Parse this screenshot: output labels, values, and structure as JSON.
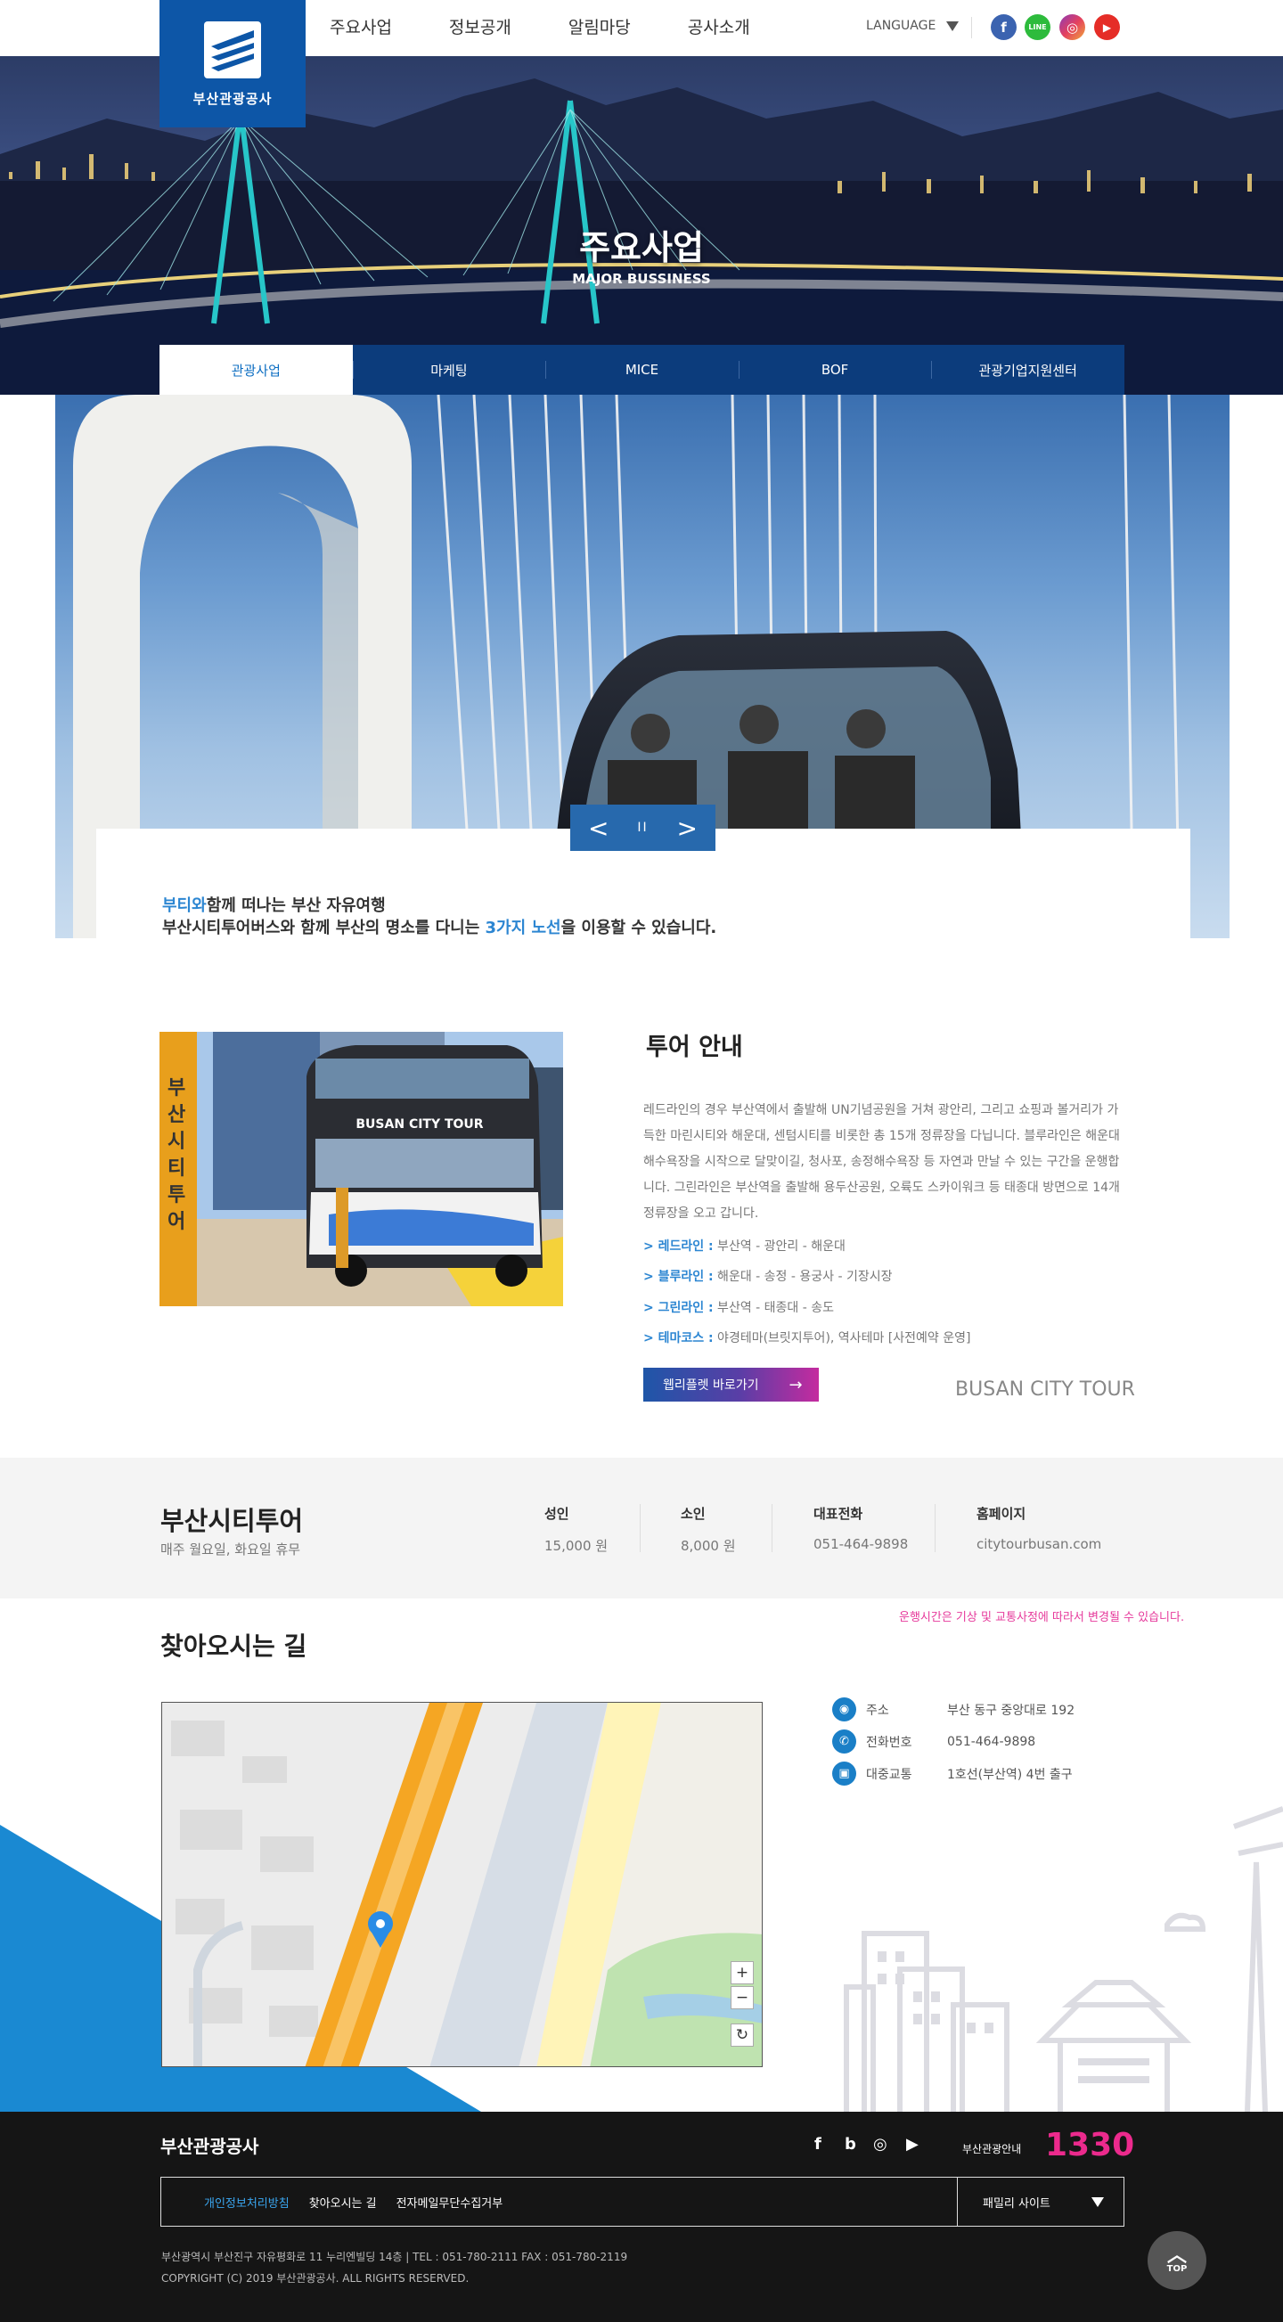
{
  "header": {
    "logo_text": "부산관광공사",
    "nav": [
      "주요사업",
      "정보공개",
      "알림마당",
      "공사소개"
    ],
    "language_label": "LANGUAGE",
    "sns": {
      "facebook": "f",
      "line": "LINE",
      "instagram": "◎",
      "youtube": "▶"
    }
  },
  "visual": {
    "title": "주요사업",
    "subtitle": "MAJOR BUSSINESS"
  },
  "subnav": [
    "관광사업",
    "마케팅",
    "MICE",
    "BOF",
    "관광기업지원센터"
  ],
  "slider": {
    "prev": "<",
    "pause": "II",
    "next": ">"
  },
  "caption": {
    "line1_highlight": "부티와",
    "line1_rest": "함께 떠나는 부산 자유여행",
    "line2_pre": "부산시티투어버스와 함께 부산의 명소를 다니는 ",
    "line2_highlight": "3가지 노선",
    "line2_post": "을 이용할 수 있습니다."
  },
  "tour": {
    "title": "투어 안내",
    "description": "레드라인의 경우 부산역에서 출발해 UN기념공원을 거쳐 광안리, 그리고 쇼핑과 볼거리가 가득한 마린시티와 해운대, 센텀시티를 비롯한 총 15개 정류장을 다닙니다. 블루라인은 해운대해수욕장을 시작으로 달맞이길, 청사포, 송정해수욕장 등 자연과 만날 수 있는 구간을 운행합니다. 그린라인은 부산역을 출발해 용두산공원, 오륙도 스카이워크 등 태종대 방면으로 14개 정류장을 오고 갑니다.",
    "routes": [
      {
        "name": "> 레드라인 :",
        "path": " 부산역 - 광안리 - 해운대"
      },
      {
        "name": "> 블루라인 :",
        "path": " 해운대 - 송정 - 용궁사 - 기장시장"
      },
      {
        "name": "> 그린라인 :",
        "path": " 부산역 - 태종대 - 송도"
      },
      {
        "name": "> 테마코스 :",
        "path": " 야경테마(브릿지투어), 역사테마 [사전예약 운영]"
      }
    ],
    "button_label": "웹리플렛 바로가기",
    "button_arrow": "→",
    "brand_text": "BUSAN CITY TOUR",
    "bus_sign": "BUSAN CITY TOUR"
  },
  "info": {
    "title": "부산시티투어",
    "subtitle": "매주 월요일, 화요일 휴무",
    "adult_label": "성인",
    "adult_price": "15,000 원",
    "child_label": "소인",
    "child_price": "8,000 원",
    "tel_label": "대표전화",
    "tel_value": "051-464-9898",
    "home_label": "홈페이지",
    "home_value": "citytourbusan.com",
    "notice": "운행시간은 기상 및 교통사정에 따라서 변경될 수 있습니다."
  },
  "directions": {
    "title": "찾아오시는 길",
    "map_controls": {
      "zoom_in": "+",
      "zoom_out": "−",
      "reset": "↻"
    },
    "locations": [
      {
        "icon": "◉",
        "label": "주소",
        "value": "부산 동구 중앙대로 192"
      },
      {
        "icon": "✆",
        "label": "전화번호",
        "value": "051-464-9898"
      },
      {
        "icon": "▣",
        "label": "대중교통",
        "value": "1호선(부산역) 4번 출구"
      }
    ]
  },
  "footer": {
    "name": "부산관광공사",
    "sns": {
      "facebook": "f",
      "blog": "b",
      "instagram": "◎",
      "youtube": "▶"
    },
    "tour_label": "부산관광안내",
    "tour_number": "1330",
    "links": [
      "개인정보처리방침",
      "찾아오시는 길",
      "전자메일무단수집거부"
    ],
    "family_site": "패밀리 사이트",
    "address": "부산광역시 부산진구 자유평화로 11 누리엔빌딩 14층  |  TEL : 051-780-2111     FAX : 051-780-2119",
    "copyright": "COPYRIGHT (C) 2019  부산관광공사. ALL RIGHTS RESERVED.",
    "top_label": "TOP"
  }
}
